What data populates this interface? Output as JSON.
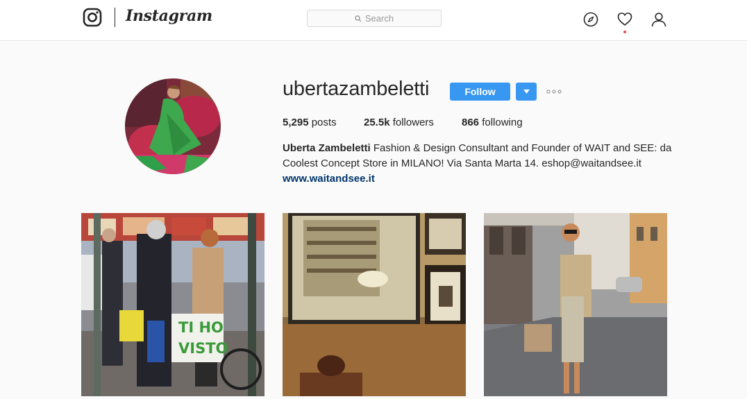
{
  "header": {
    "brand": "Instagram",
    "search_placeholder": "Search",
    "icons": [
      "instagram-glyph-icon",
      "search-icon",
      "compass-icon",
      "heart-icon",
      "person-icon"
    ],
    "notification_dot_color": "#ed4956"
  },
  "profile": {
    "username": "ubertazambeletti",
    "follow_label": "Follow",
    "follow_color": "#3897f0",
    "stats": {
      "posts_count": "5,295",
      "posts_label": "posts",
      "followers_count": "25.5k",
      "followers_label": "followers",
      "following_count": "866",
      "following_label": "following"
    },
    "bio": {
      "full_name": "Uberta Zambeletti",
      "line1": "Fashion & Design Consultant and Founder of WAIT and SEE: da",
      "line2": "Coolest Concept Store in MILANO! Via Santa Marta 14. eshop@waitandsee.it",
      "website": "www.waitandsee.it"
    }
  },
  "posts": [
    {
      "sign_text_1": "TI HO",
      "sign_text_2": "VISTO"
    },
    {},
    {}
  ]
}
